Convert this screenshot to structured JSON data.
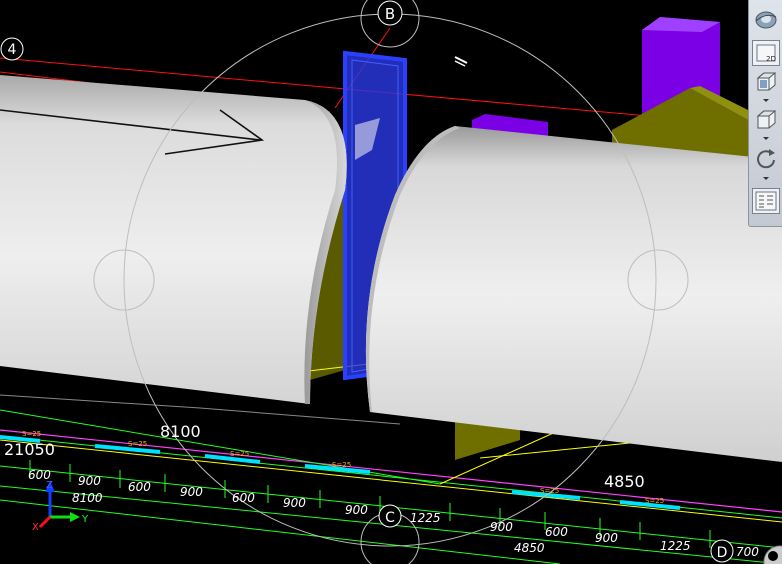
{
  "viewport": {
    "grid_labels": {
      "top": "B",
      "left": "4",
      "bottom": "C",
      "bottom_right": "D"
    },
    "dimensions": {
      "d_21050": "21050",
      "d_8100_large": "8100",
      "d_4850_large": "4850",
      "d_600_a": "600",
      "d_900_a": "900",
      "d_8100_small": "8100",
      "d_600_b": "600",
      "d_900_b": "900",
      "d_600_c": "600",
      "d_900_c": "900",
      "d_900_d": "900",
      "d_1225_a": "1225",
      "d_900_e": "900",
      "d_600_d": "600",
      "d_900_f": "900",
      "d_1225_b": "1225",
      "d_4850_small": "4850",
      "d_700": "700"
    },
    "axis": {
      "x": "X",
      "y": "Y",
      "z": "Z"
    }
  },
  "toolbar": {
    "items": [
      {
        "name": "orbit-globe",
        "label": ""
      },
      {
        "name": "view-2d",
        "label": "2D"
      },
      {
        "name": "view-3d",
        "label": ""
      },
      {
        "name": "view-cube",
        "label": ""
      },
      {
        "name": "rotate",
        "label": ""
      },
      {
        "name": "properties",
        "label": ""
      }
    ]
  },
  "colors": {
    "background": "#000000",
    "grid_line": "#ff1010",
    "rebar_green": "#22ff22",
    "dim_yellow": "#ffff00",
    "cyan_segment": "#00e0ff",
    "magenta_line": "#ff40ff",
    "purple_column": "#8a00ff",
    "olive_wall": "#7a7a00",
    "blue_panel": "#2030ff",
    "steering_circle": "#c8c8c8"
  }
}
